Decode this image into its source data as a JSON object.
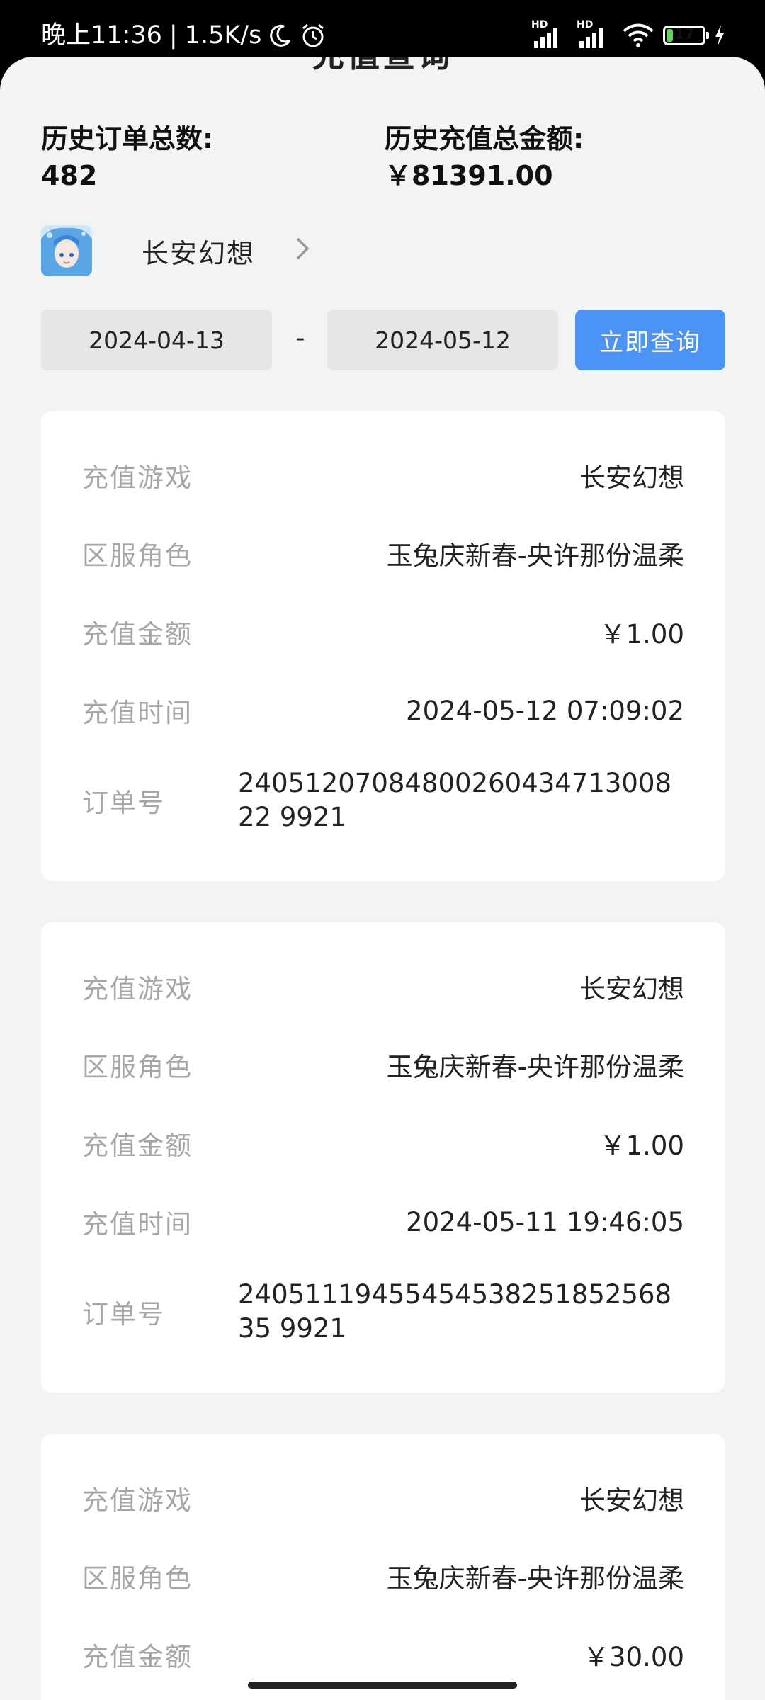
{
  "status_bar": {
    "time": "晚上11:36",
    "net_speed": "1.5K/s",
    "hd_1": "HD",
    "hd_2": "HD",
    "battery": "17",
    "battery_level": 0.17,
    "colors": {
      "battery_fill": "#5ad95a"
    }
  },
  "header": {
    "title": "充值查询"
  },
  "summary": {
    "total_orders_label": "历史订单总数:",
    "total_orders_value": "482",
    "total_amount_label": "历史充值总金额:",
    "total_amount_value": "￥81391.00"
  },
  "game_selector": {
    "name": "长安幻想",
    "chevron": "chevron-right-icon"
  },
  "query": {
    "start_date": "2024-04-13",
    "separator": "-",
    "end_date": "2024-05-12",
    "button_label": "立即查询",
    "button_color": "#4b94f5"
  },
  "orders": [
    {
      "game_label": "充值游戏",
      "game": "长安幻想",
      "role_label": "区服角色",
      "role": "玉兔庆新春-央许那份温柔",
      "amount_label": "充值金额",
      "amount": "￥1.00",
      "time_label": "充值时间",
      "time": "2024-05-12 07:09:02",
      "order_label": "订单号",
      "order_no": "2405120708480026043471300822 9921"
    },
    {
      "game_label": "充值游戏",
      "game": "长安幻想",
      "role_label": "区服角色",
      "role": "玉兔庆新春-央许那份温柔",
      "amount_label": "充值金额",
      "amount": "￥1.00",
      "time_label": "充值时间",
      "time": "2024-05-11 19:46:05",
      "order_label": "订单号",
      "order_no": "2405111945545453825185256835 9921"
    },
    {
      "game_label": "充值游戏",
      "game": "长安幻想",
      "role_label": "区服角色",
      "role": "玉兔庆新春-央许那份温柔",
      "amount_label": "充值金额",
      "amount": "￥30.00"
    }
  ]
}
